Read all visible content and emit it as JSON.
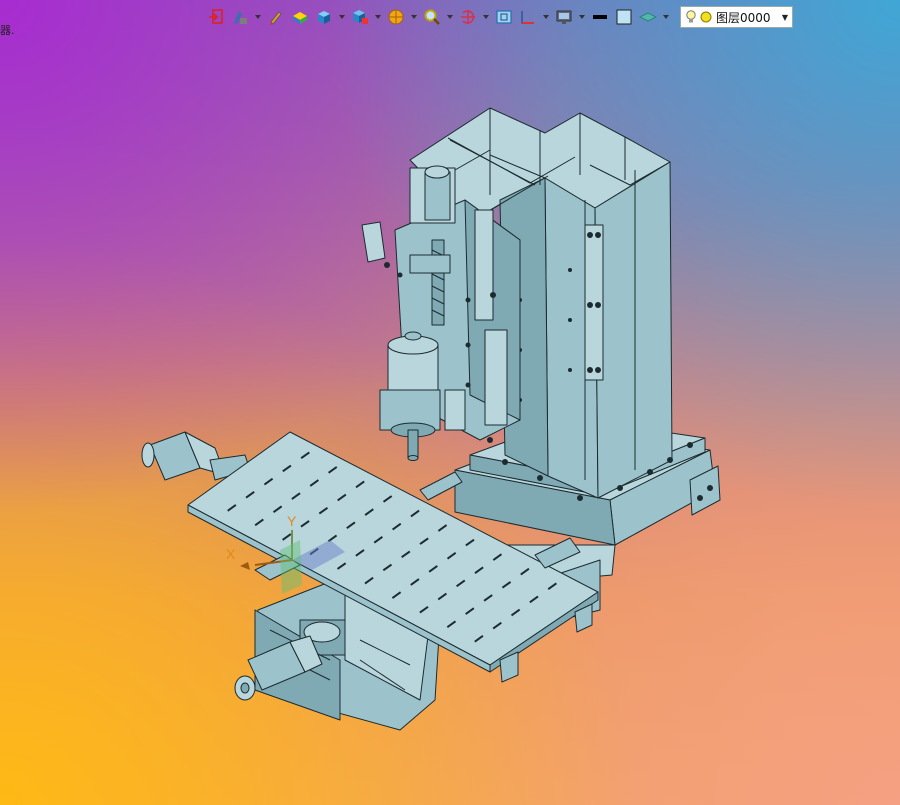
{
  "side_text": "器.",
  "toolbar": {
    "items": [
      {
        "icon": "exit-sketch-icon",
        "caret": false
      },
      {
        "icon": "smart-pen-icon",
        "caret": true
      },
      {
        "icon": "pencil-icon",
        "caret": false
      },
      {
        "icon": "color-cubes-icon",
        "caret": false
      },
      {
        "icon": "solid-cube-icon",
        "caret": true
      },
      {
        "icon": "view-orientation-icon",
        "caret": true
      },
      {
        "icon": "render-style-icon",
        "caret": true
      },
      {
        "icon": "zoom-icon",
        "caret": true
      },
      {
        "icon": "rotate-view-icon",
        "caret": true
      },
      {
        "icon": "zoom-window-icon",
        "caret": false
      },
      {
        "icon": "section-view-icon",
        "caret": true
      },
      {
        "icon": "display-monitor-icon",
        "caret": true
      },
      {
        "icon": "line-color-icon",
        "caret": false
      },
      {
        "icon": "fill-color-icon",
        "caret": false
      },
      {
        "icon": "layer-plane-icon",
        "caret": true
      }
    ],
    "layer": {
      "label": "图层0000"
    }
  },
  "viewport": {
    "axes": {
      "x": "X",
      "y": "Y"
    },
    "colors": {
      "part": "#9cc3cc",
      "edge": "#1c2b30",
      "axis_label": "#e08a1a"
    }
  }
}
